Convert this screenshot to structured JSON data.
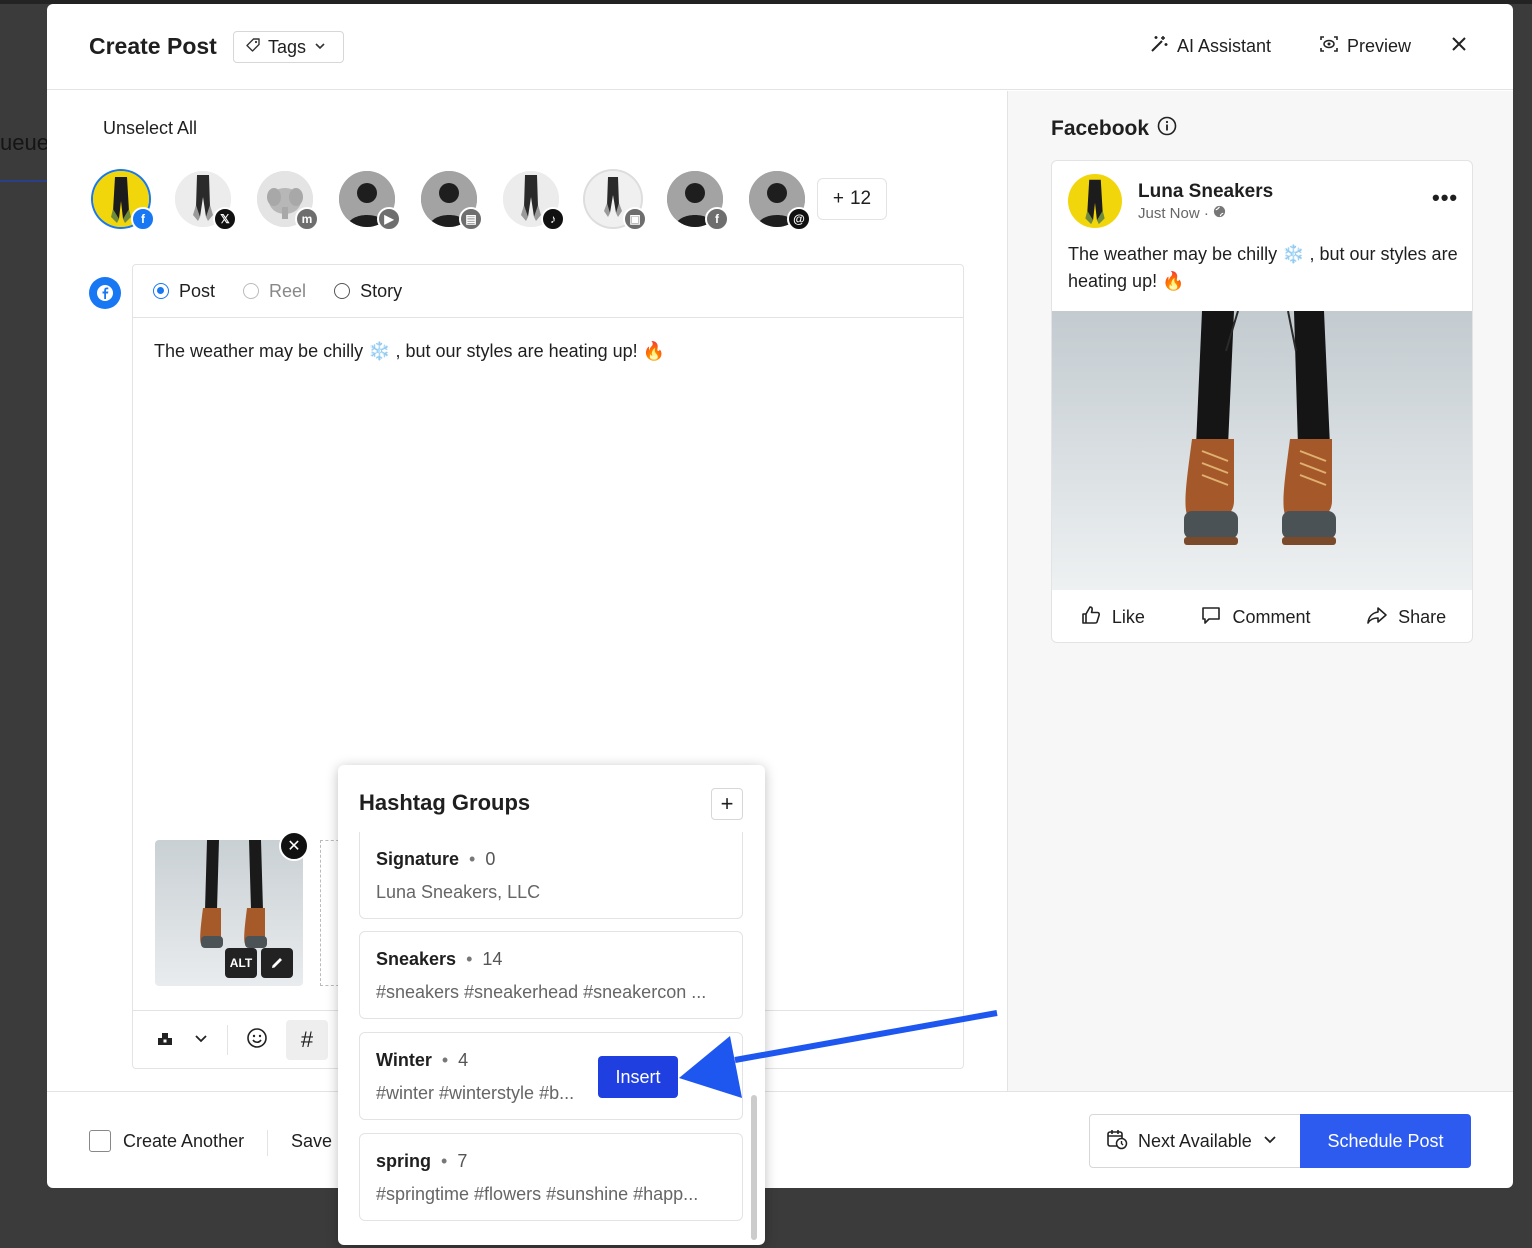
{
  "background": {
    "queue_label": "ueue"
  },
  "header": {
    "title": "Create Post",
    "tags_label": "Tags",
    "ai_label": "AI Assistant",
    "preview_label": "Preview"
  },
  "accounts": {
    "unselect_label": "Unselect All",
    "more_count": "12",
    "items": [
      {
        "network": "facebook",
        "selected": true
      },
      {
        "network": "x"
      },
      {
        "network": "mastodon"
      },
      {
        "network": "youtube"
      },
      {
        "network": "google-business"
      },
      {
        "network": "tiktok"
      },
      {
        "network": "pinterest"
      },
      {
        "network": "facebook"
      },
      {
        "network": "threads"
      }
    ]
  },
  "editor": {
    "type_options": [
      {
        "label": "Post",
        "state": "selected"
      },
      {
        "label": "Reel",
        "state": "disabled"
      },
      {
        "label": "Story",
        "state": "unselected"
      }
    ],
    "text": "The weather may be chilly ❄️ , but our styles are heating up! 🔥",
    "alt_label": "ALT"
  },
  "footer": {
    "create_another_label": "Create Another",
    "save_label": "Save I",
    "next_available_label": "Next Available",
    "schedule_label": "Schedule Post"
  },
  "preview": {
    "network_title": "Facebook",
    "account_name": "Luna Sneakers",
    "timestamp": "Just Now ·",
    "text": "The weather may be chilly ❄️ , but our styles are heating up! 🔥",
    "actions": {
      "like": "Like",
      "comment": "Comment",
      "share": "Share"
    }
  },
  "hashtag_popover": {
    "title": "Hashtag Groups",
    "insert_label": "Insert",
    "groups": [
      {
        "name": "Signature",
        "count": "0",
        "content": "Luna Sneakers, LLC"
      },
      {
        "name": "Sneakers",
        "count": "14",
        "content": "#sneakers #sneakerhead #sneakercon ..."
      },
      {
        "name": "Winter",
        "count": "4",
        "content": "#winter #winterstyle #b..."
      },
      {
        "name": "spring",
        "count": "7",
        "content": "#springtime #flowers #sunshine #happ..."
      }
    ]
  },
  "colors": {
    "facebook": "#1877f2",
    "schedule_button": "#2d5bf0",
    "insert_button": "#1f3fe0",
    "annotation_arrow": "#1e56f0"
  }
}
